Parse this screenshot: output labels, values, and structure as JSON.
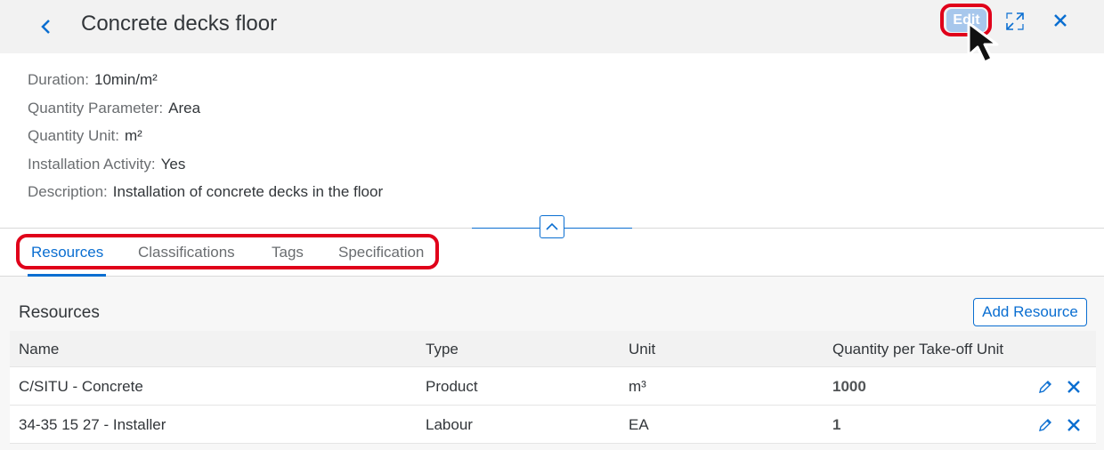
{
  "header": {
    "title": "Concrete decks floor",
    "edit_label": "Edit"
  },
  "details": {
    "duration": {
      "label": "Duration:",
      "value": "10min/m²"
    },
    "quantity_parameter": {
      "label": "Quantity Parameter:",
      "value": "Area"
    },
    "quantity_unit": {
      "label": "Quantity Unit:",
      "value": "m²"
    },
    "installation_activity": {
      "label": "Installation Activity:",
      "value": "Yes"
    },
    "description": {
      "label": "Description:",
      "value": "Installation of concrete decks in the floor"
    }
  },
  "tabs": [
    {
      "label": "Resources",
      "active": true
    },
    {
      "label": "Classifications",
      "active": false
    },
    {
      "label": "Tags",
      "active": false
    },
    {
      "label": "Specification",
      "active": false
    }
  ],
  "resources": {
    "title": "Resources",
    "add_label": "Add Resource",
    "columns": [
      "Name",
      "Type",
      "Unit",
      "Quantity per Take-off Unit"
    ],
    "rows": [
      {
        "name": "C/SITU - Concrete",
        "type": "Product",
        "unit": "m³",
        "quantity": "1000"
      },
      {
        "name": "34-35 15 27 - Installer",
        "type": "Labour",
        "unit": "EA",
        "quantity": "1"
      }
    ]
  },
  "icons": {
    "back": "chevron-left-icon",
    "fullscreen": "fullscreen-icon",
    "close": "close-icon",
    "collapse": "chevron-up-icon",
    "row_edit": "pencil-icon",
    "row_delete": "delete-x-icon",
    "cursor": "mouse-pointer-icon"
  },
  "colors": {
    "accent": "#0a6ed1",
    "highlight": "#e0001a",
    "edit_button_bg": "#a7c7ec"
  }
}
